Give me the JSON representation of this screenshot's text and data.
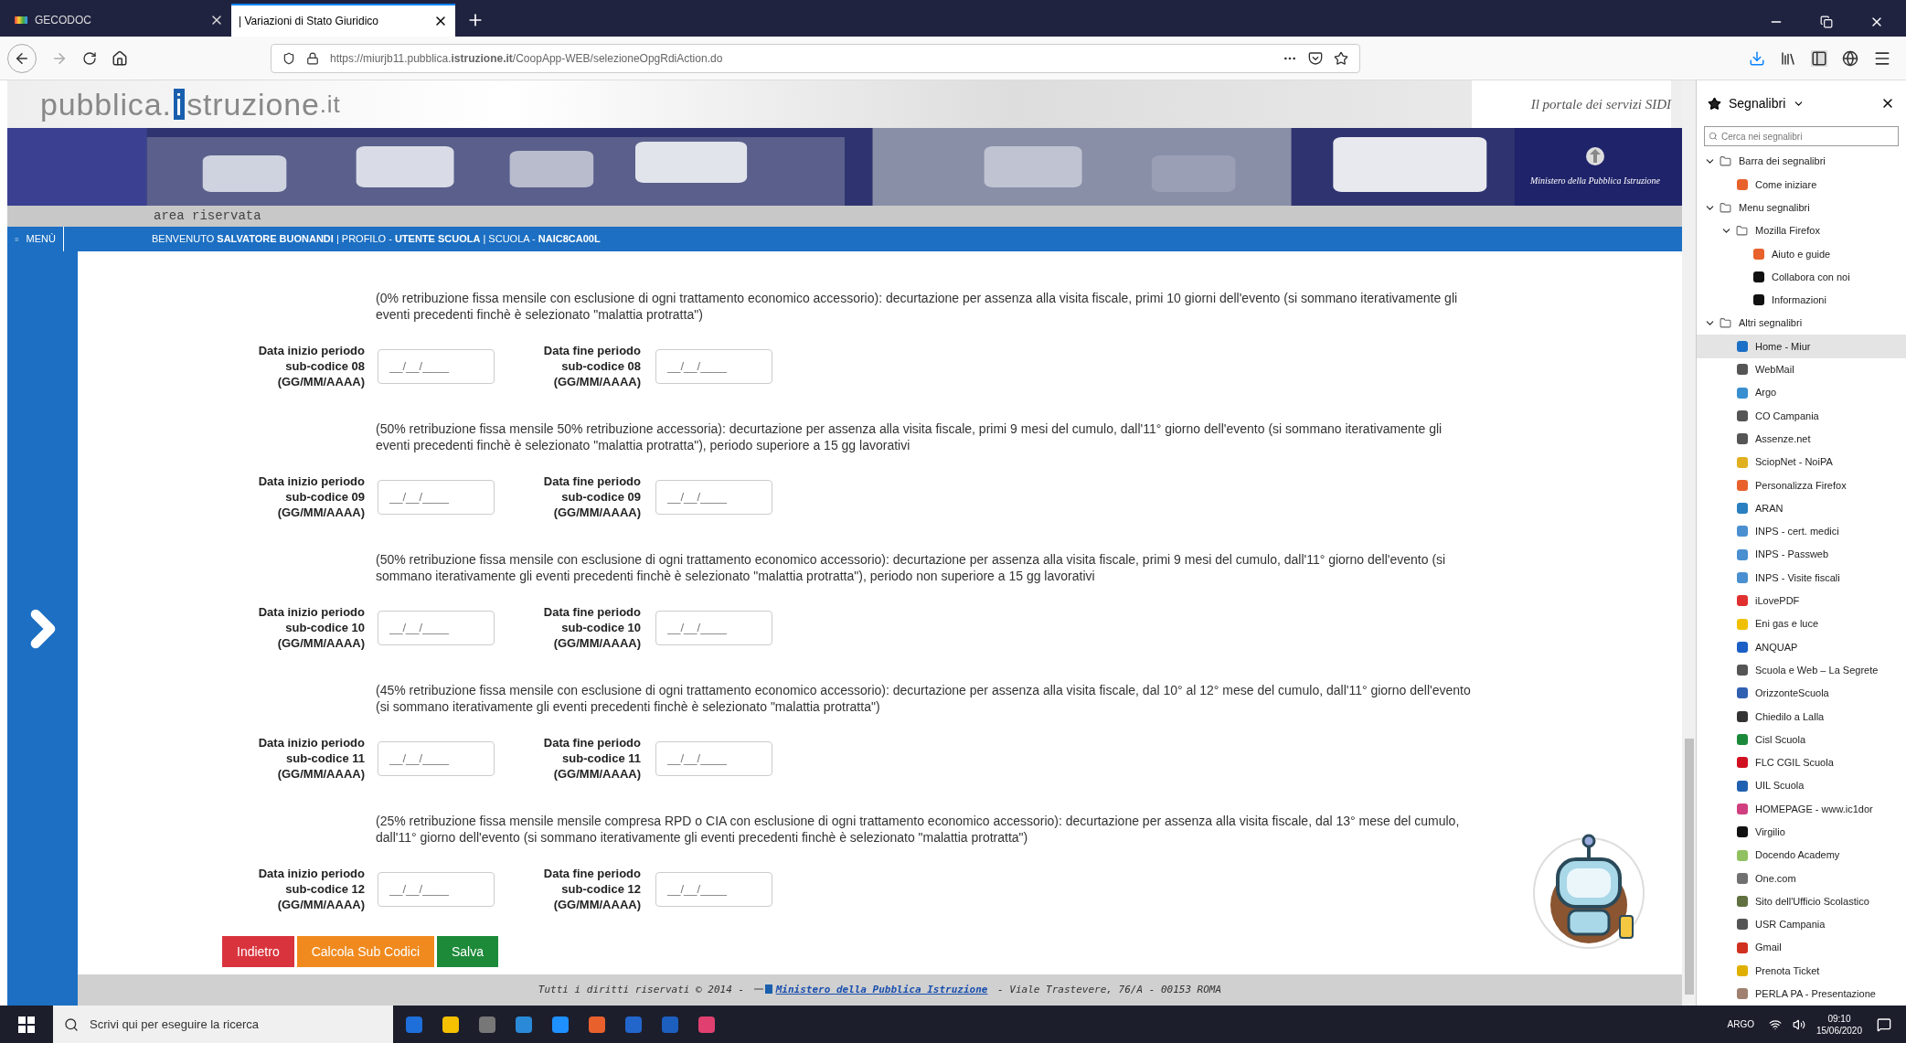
{
  "browser": {
    "tabs": [
      {
        "label": "GECODOC",
        "selected": false
      },
      {
        "label": "| Variazioni di Stato Giuridico",
        "selected": true
      }
    ],
    "url": "https://miurjb11.pubblica.**istruzione.it**/CoopApp-WEB/selezioneOpgRdiAction.do"
  },
  "header": {
    "logo": [
      "pubblica.",
      "i",
      "struzione",
      ".it"
    ],
    "tagline": "Il portale dei servizi SIDI",
    "ministry": "Ministero della Pubblica Istruzione",
    "area": "area riservata",
    "menu": "MENÙ",
    "welcome": "BENVENUTO **SALVATORE BUONANDI** | PROFILO - **UTENTE SCUOLA** | SCUOLA - **NAIC8CA00L**"
  },
  "sections": [
    {
      "description": "(0% retribuzione fissa mensile con esclusione di ogni trattamento economico accessorio): decurtazione per assenza alla visita fiscale, primi 10 giorni dell'evento (si sommano iterativamente gli eventi precedenti finchè è selezionato \"malattia protratta\")",
      "start_label": [
        "Data inizio periodo",
        "sub-codice 08",
        "(GG/MM/AAAA)"
      ],
      "end_label": [
        "Data fine periodo",
        "sub-codice 08",
        "(GG/MM/AAAA)"
      ],
      "start_placeholder": "__/__/____",
      "end_placeholder": "__/__/____"
    },
    {
      "description": "(50% retribuzione fissa mensile 50% retribuzione accessoria): decurtazione per assenza alla visita fiscale, primi 9 mesi del cumulo, dall'11° giorno dell'evento (si sommano iterativamente gli eventi precedenti finchè è selezionato \"malattia protratta\"), periodo superiore a 15 gg lavorativi",
      "start_label": [
        "Data inizio periodo",
        "sub-codice 09",
        "(GG/MM/AAAA)"
      ],
      "end_label": [
        "Data fine periodo",
        "sub-codice 09",
        "(GG/MM/AAAA)"
      ],
      "start_placeholder": "__/__/____",
      "end_placeholder": "__/__/____"
    },
    {
      "description": "(50% retribuzione fissa mensile con esclusione di ogni trattamento economico accessorio): decurtazione per assenza alla visita fiscale, primi 9 mesi del cumulo, dall'11° giorno dell'evento (si sommano iterativamente gli eventi precedenti finchè è selezionato \"malattia protratta\"), periodo non superiore a 15 gg lavorativi",
      "start_label": [
        "Data inizio periodo",
        "sub-codice 10",
        "(GG/MM/AAAA)"
      ],
      "end_label": [
        "Data fine periodo",
        "sub-codice 10",
        "(GG/MM/AAAA)"
      ],
      "start_placeholder": "__/__/____",
      "end_placeholder": "__/__/____"
    },
    {
      "description": "(45% retribuzione fissa mensile con esclusione di ogni trattamento economico accessorio): decurtazione per assenza alla visita fiscale, dal 10° al 12° mese del cumulo, dall'11° giorno dell'evento (si sommano iterativamente gli eventi precedenti finchè è selezionato \"malattia protratta\")",
      "start_label": [
        "Data inizio periodo",
        "sub-codice 11",
        "(GG/MM/AAAA)"
      ],
      "end_label": [
        "Data fine periodo",
        "sub-codice 11",
        "(GG/MM/AAAA)"
      ],
      "start_placeholder": "__/__/____",
      "end_placeholder": "__/__/____"
    },
    {
      "description": "(25% retribuzione fissa mensile mensile compresa RPD o CIA con esclusione di ogni trattamento economico accessorio): decurtazione per assenza alla visita fiscale, dal 13° mese del cumulo, dall'11° giorno dell'evento (si sommano iterativamente gli eventi precedenti finchè è selezionato \"malattia protratta\")",
      "start_label": [
        "Data inizio periodo",
        "sub-codice 12",
        "(GG/MM/AAAA)"
      ],
      "end_label": [
        "Data fine periodo",
        "sub-codice 12",
        "(GG/MM/AAAA)"
      ],
      "start_placeholder": "__/__/____",
      "end_placeholder": "__/__/____"
    }
  ],
  "buttons": [
    {
      "label": "Indietro",
      "kind": "back"
    },
    {
      "label": "Calcola Sub Codici",
      "kind": "calc"
    },
    {
      "label": "Salva",
      "kind": "save"
    }
  ],
  "footer": {
    "prefix": "Tutti i diritti riservati © 2014 - ",
    "link": "Ministero della Pubblica Istruzione",
    "suffix": " - Viale Trastevere, 76/A - 00153 ROMA"
  },
  "bookmarks": {
    "title": "Segnalibri",
    "search_placeholder": "Cerca nei segnalibri",
    "items": [
      {
        "label": "Barra dei segnalibri",
        "kind": "folder",
        "expanded": true,
        "selected": false,
        "children": [
          {
            "label": "Come iniziare",
            "kind": "link",
            "color": "#e8612c",
            "selected": false
          }
        ]
      },
      {
        "label": "Menu segnalibri",
        "kind": "folder",
        "expanded": true,
        "selected": false,
        "children": [
          {
            "label": "Mozilla Firefox",
            "kind": "folder",
            "expanded": true,
            "selected": false,
            "children": [
              {
                "label": "Aiuto e guide",
                "kind": "link",
                "color": "#e8612c",
                "selected": false
              },
              {
                "label": "Collabora con noi",
                "kind": "link",
                "color": "#111111",
                "selected": false
              },
              {
                "label": "Informazioni",
                "kind": "link",
                "color": "#111111",
                "selected": false
              }
            ]
          }
        ]
      },
      {
        "label": "Altri segnalibri",
        "kind": "folder",
        "expanded": true,
        "selected": false,
        "children": [
          {
            "label": "Home - Miur",
            "kind": "link",
            "color": "#1c6fc7",
            "selected": true
          },
          {
            "label": "WebMail",
            "kind": "link",
            "color": "#555555",
            "selected": false
          },
          {
            "label": "Argo",
            "kind": "link",
            "color": "#3a8fd0",
            "selected": false
          },
          {
            "label": "CO Campania",
            "kind": "link",
            "color": "#555555",
            "selected": false
          },
          {
            "label": "Assenze.net",
            "kind": "link",
            "color": "#555555",
            "selected": false
          },
          {
            "label": "SciopNet - NoiPA",
            "kind": "link",
            "color": "#e0b020",
            "selected": false
          },
          {
            "label": "Personalizza Firefox",
            "kind": "link",
            "color": "#e8612c",
            "selected": false
          },
          {
            "label": "ARAN",
            "kind": "link",
            "color": "#2a7fc0",
            "selected": false
          },
          {
            "label": "INPS - cert. medici",
            "kind": "link",
            "color": "#4a90d0",
            "selected": false
          },
          {
            "label": "INPS - Passweb",
            "kind": "link",
            "color": "#4a90d0",
            "selected": false
          },
          {
            "label": "INPS - Visite fiscali",
            "kind": "link",
            "color": "#4a90d0",
            "selected": false
          },
          {
            "label": "iLovePDF",
            "kind": "link",
            "color": "#e03030",
            "selected": false
          },
          {
            "label": "Eni gas e luce",
            "kind": "link",
            "color": "#f0c000",
            "selected": false
          },
          {
            "label": "ANQUAP",
            "kind": "link",
            "color": "#1c5fc7",
            "selected": false
          },
          {
            "label": "Scuola e Web – La Segrete",
            "kind": "link",
            "color": "#555555",
            "selected": false
          },
          {
            "label": "OrizzonteScuola",
            "kind": "link",
            "color": "#3060b0",
            "selected": false
          },
          {
            "label": "Chiedilo a Lalla",
            "kind": "link",
            "color": "#333333",
            "selected": false
          },
          {
            "label": "Cisl Scuola",
            "kind": "link",
            "color": "#1a8a3a",
            "selected": false
          },
          {
            "label": "FLC CGIL Scuola",
            "kind": "link",
            "color": "#d01020",
            "selected": false
          },
          {
            "label": "UIL Scuola",
            "kind": "link",
            "color": "#2060b0",
            "selected": false
          },
          {
            "label": "HOMEPAGE - www.ic1dor",
            "kind": "link",
            "color": "#d04080",
            "selected": false
          },
          {
            "label": "Virgilio",
            "kind": "link",
            "color": "#111111",
            "selected": false
          },
          {
            "label": "Docendo Academy",
            "kind": "link",
            "color": "#90c060",
            "selected": false
          },
          {
            "label": "One.com",
            "kind": "link",
            "color": "#707070",
            "selected": false
          },
          {
            "label": "Sito dell'Ufficio Scolastico",
            "kind": "link",
            "color": "#607040",
            "selected": false
          },
          {
            "label": "USR Campania",
            "kind": "link",
            "color": "#555555",
            "selected": false
          },
          {
            "label": "Gmail",
            "kind": "link",
            "color": "#d03020",
            "selected": false
          },
          {
            "label": "Prenota Ticket",
            "kind": "link",
            "color": "#e0b000",
            "selected": false
          },
          {
            "label": "PERLA PA - Presentazione",
            "kind": "link",
            "color": "#a08070",
            "selected": false
          }
        ]
      }
    ]
  },
  "taskbar": {
    "search_placeholder": "Scrivi qui per eseguire la ricerca",
    "user": "ARGO",
    "time": "09:10",
    "date": "15/06/2020"
  }
}
